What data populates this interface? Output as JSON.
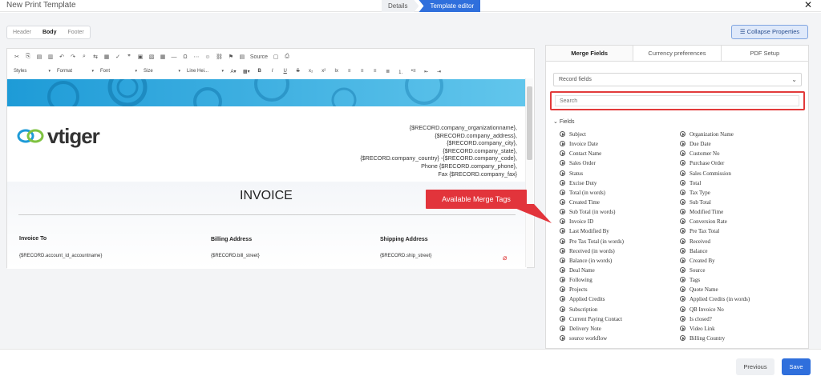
{
  "app": {
    "title": "New Print Template"
  },
  "steps": [
    "Details",
    "Template editor"
  ],
  "segtabs": [
    "Header",
    "Body",
    "Footer"
  ],
  "collapse_label": "Collapse Properties",
  "toolbar": {
    "source_label": "Source",
    "dropdowns": [
      "Styles",
      "Format",
      "Font",
      "Size",
      "Line Hei..."
    ]
  },
  "document": {
    "logo_text": "vtiger",
    "company_lines": [
      "{$RECORD.company_organizationname},",
      "{$RECORD.company_address},",
      "{$RECORD.company_city},",
      "{$RECORD.company_state},",
      "{$RECORD.company_country} -{$RECORD.company_code},",
      "Phone {$RECORD.company_phone},",
      "Fax {$RECORD.company_fax}"
    ],
    "invoice_title": "INVOICE",
    "invoice_to": "Invoice To",
    "billing": "Billing Address",
    "shipping": "Shipping Address",
    "row1": "{$RECORD.account_id_accountname}",
    "row2": "{$RECORD.bill_street}",
    "row3": "{$RECORD.ship_street}"
  },
  "callout": "Available Merge Tags",
  "panel": {
    "tabs": [
      "Merge Fields",
      "Currency preferences",
      "PDF Setup"
    ],
    "record_fields": "Record fields",
    "search_placeholder": "Search",
    "fields_header": "Fields",
    "left_fields": [
      "Subject",
      "Invoice Date",
      "Contact Name",
      "Sales Order",
      "Status",
      "Excise Duty",
      "Total (in words)",
      "Created Time",
      "Sub Total (in words)",
      "Invoice ID",
      "Last Modified By",
      "Pre Tax Total (in words)",
      "Received (in words)",
      "Balance (in words)",
      "Deal Name",
      "Following",
      "Projects",
      "Applied Credits",
      "Subscription",
      "Current Paying Contact",
      "Delivery Note",
      "source workflow"
    ],
    "right_fields": [
      "Organization Name",
      "Due Date",
      "Customer No",
      "Purchase Order",
      "Sales Commission",
      "Total",
      "Tax Type",
      "Sub Total",
      "Modified Time",
      "Conversion Rate",
      "Pre Tax Total",
      "Received",
      "Balance",
      "Created By",
      "Source",
      "Tags",
      "Quote Name",
      "Applied Credits (in words)",
      "QB Invoice No",
      "Is closed?",
      "Video Link",
      "Billing Country"
    ]
  },
  "buttons": {
    "previous": "Previous",
    "save": "Save"
  }
}
